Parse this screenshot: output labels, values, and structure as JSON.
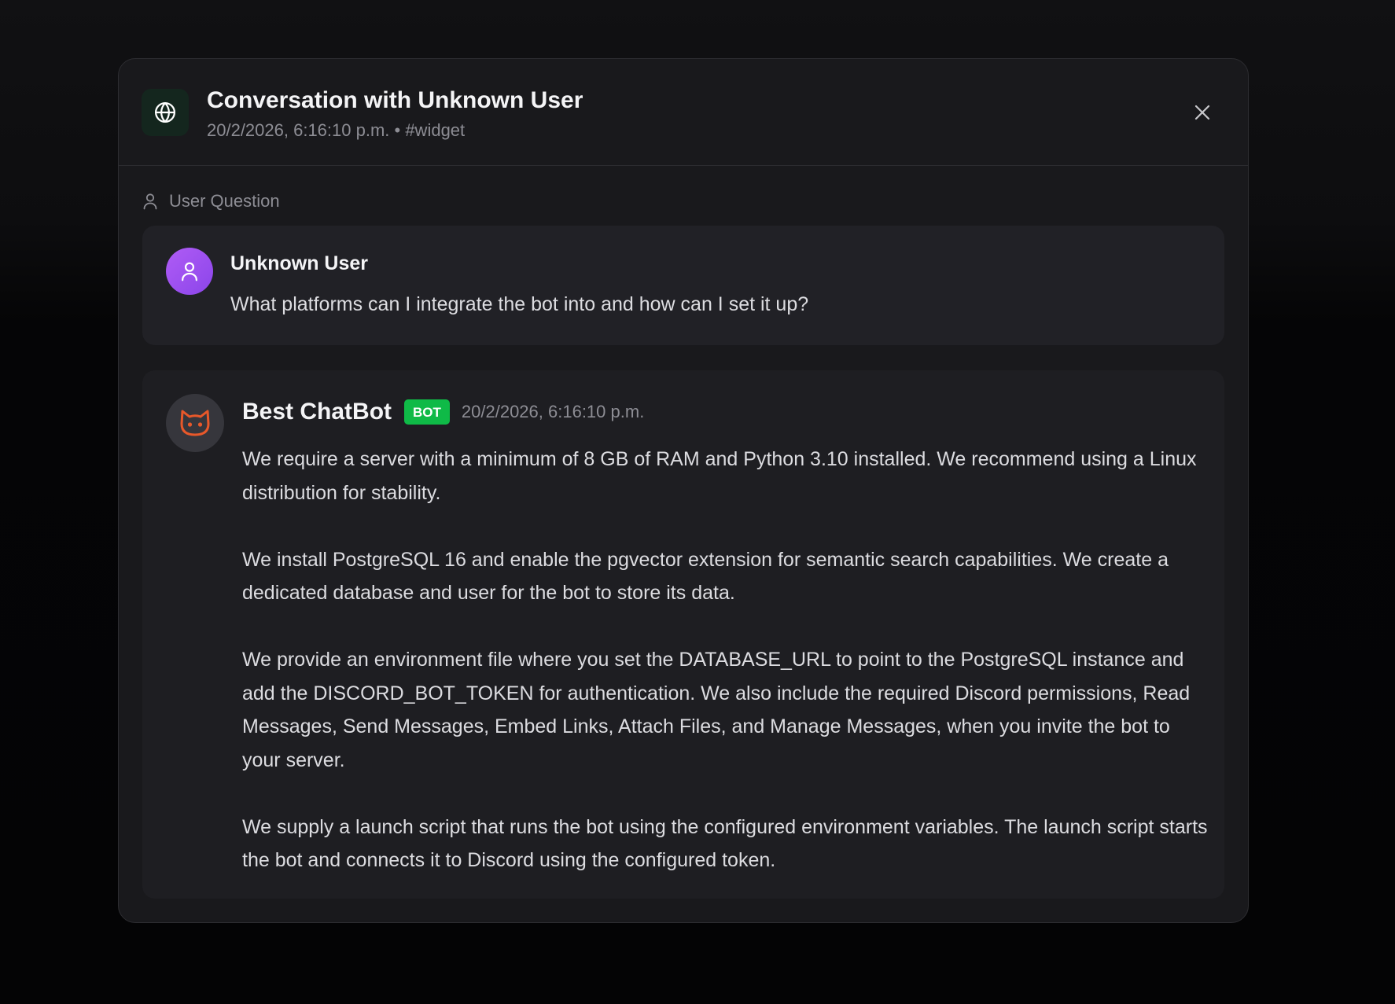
{
  "header": {
    "title": "Conversation with Unknown User",
    "meta": "20/2/2026, 6:16:10 p.m. • #widget",
    "close_label": "Close"
  },
  "user_section": {
    "label": "User Question",
    "name": "Unknown User",
    "message": "What platforms can I integrate the bot into and how can I set it up?"
  },
  "bot_reply": {
    "name": "Best ChatBot",
    "badge": "BOT",
    "timestamp": "20/2/2026, 6:16:10 p.m.",
    "paragraphs": [
      "We require a server with a minimum of 8 GB of RAM and Python 3.10 installed. We recommend using a Linux distribution for stability.",
      "We install PostgreSQL 16 and enable the pgvector extension for semantic search capabilities. We create a dedicated database and user for the bot to store its data.",
      "We provide an environment file where you set the DATABASE_URL to point to the PostgreSQL instance and add the DISCORD_BOT_TOKEN for authentication. We also include the required Discord permissions, Read Messages, Send Messages, Embed Links, Attach Files, and Manage Messages, when you invite the bot to your server.",
      "We supply a launch script that runs the bot using the configured environment variables. The launch script starts the bot and connects it to Discord using the configured token."
    ]
  },
  "icons": {
    "channel": "globe-icon",
    "close": "close-icon",
    "section": "user-icon",
    "user_avatar": "user-icon",
    "bot_avatar": "cat-face-icon"
  },
  "colors": {
    "background": "#050506",
    "modal": "#19191c",
    "card": "#212126",
    "bot_badge": "#0fba47",
    "user_avatar": "#9b50f0",
    "bot_icon": "#e8582a",
    "channel_icon_bg": "#14261e"
  }
}
